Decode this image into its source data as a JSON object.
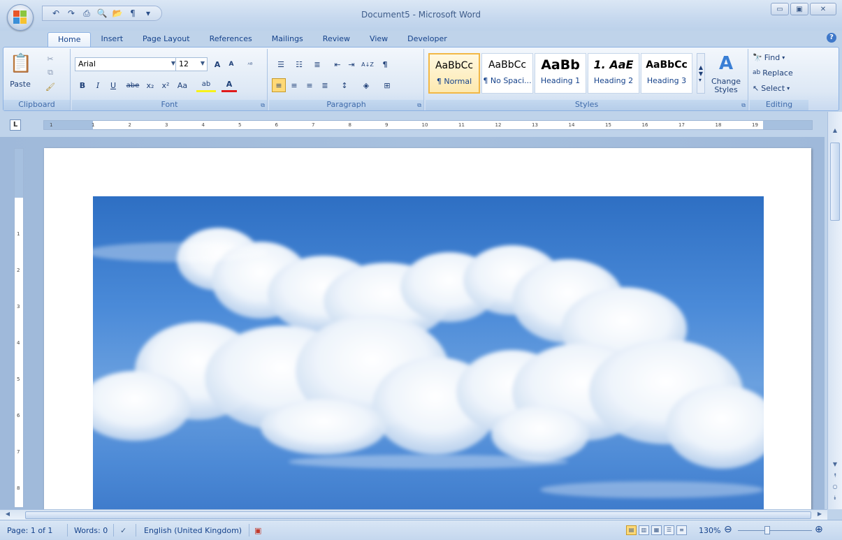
{
  "window": {
    "title": "Document5 - Microsoft Word",
    "minimize": "▭",
    "maximize": "▣",
    "close": "✕"
  },
  "qat": {
    "undo": "↶",
    "redo": "↷",
    "print": "⎙",
    "preview": "🔍",
    "open": "📂",
    "pilcrow": "¶",
    "customize": "▾"
  },
  "tabs": [
    "Home",
    "Insert",
    "Page Layout",
    "References",
    "Mailings",
    "Review",
    "View",
    "Developer"
  ],
  "help": "?",
  "clipboard": {
    "label": "Clipboard",
    "paste": "Paste"
  },
  "font": {
    "label": "Font",
    "name": "Arial",
    "size": "12",
    "grow": "A",
    "shrink": "A",
    "clear": "ᴬᴮ",
    "bold": "B",
    "italic": "I",
    "underline": "U",
    "strike": "abe",
    "subscript": "x₂",
    "superscript": "x²",
    "case": "Aa",
    "highlight": "ab",
    "color": "A"
  },
  "paragraph": {
    "label": "Paragraph",
    "sort": "A↓Z",
    "show": "¶"
  },
  "styles": {
    "label": "Styles",
    "items": [
      {
        "sample": "AaBbCc",
        "name": "¶ Normal"
      },
      {
        "sample": "AaBbCc",
        "name": "¶ No Spaci..."
      },
      {
        "sample": "AaBb",
        "name": "Heading 1"
      },
      {
        "sample": "1. AaE",
        "name": "Heading 2"
      },
      {
        "sample": "AaBbCc",
        "name": "Heading 3"
      }
    ],
    "change": "Change Styles"
  },
  "editing": {
    "label": "Editing",
    "find": "Find",
    "replace": "Replace",
    "select": "Select"
  },
  "ruler": {
    "tab_selector": "L",
    "numbers": [
      "1",
      "1",
      "2",
      "3",
      "4",
      "5",
      "6",
      "7",
      "8",
      "9",
      "10",
      "11",
      "12",
      "13",
      "14",
      "15",
      "16",
      "17",
      "18",
      "19"
    ],
    "vnumbers": [
      "1",
      "2",
      "3",
      "4",
      "5",
      "6",
      "7",
      "8"
    ]
  },
  "status": {
    "page": "Page: 1 of 1",
    "words": "Words: 0",
    "language": "English (United Kingdom)",
    "zoom": "130%"
  }
}
